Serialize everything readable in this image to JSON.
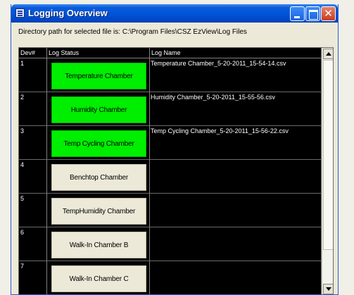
{
  "window": {
    "title": "Logging Overview"
  },
  "path_label": "Directory path for selected file is: C:\\Program Files\\CSZ EzView\\Log Files",
  "table": {
    "headers": {
      "dev": "Dev#",
      "status": "Log Status",
      "name": "Log Name"
    },
    "rows": [
      {
        "dev": "1",
        "status": "Temperature Chamber",
        "active": true,
        "log_name": "Temperature Chamber_5-20-2011_15-54-14.csv"
      },
      {
        "dev": "2",
        "status": "Humidity Chamber",
        "active": true,
        "log_name": "Humidity Chamber_5-20-2011_15-55-56.csv"
      },
      {
        "dev": "3",
        "status": "Temp Cycling Chamber",
        "active": true,
        "log_name": "Temp Cycling Chamber_5-20-2011_15-56-22.csv"
      },
      {
        "dev": "4",
        "status": "Benchtop Chamber",
        "active": false,
        "log_name": ""
      },
      {
        "dev": "5",
        "status": "TempHumidity Chamber",
        "active": false,
        "log_name": ""
      },
      {
        "dev": "6",
        "status": "Walk-In Chamber B",
        "active": false,
        "log_name": ""
      },
      {
        "dev": "7",
        "status": "Walk-In Chamber C",
        "active": false,
        "log_name": ""
      }
    ]
  },
  "colors": {
    "active_status": "#00ee00",
    "inactive_status": "#ece9d8",
    "grid_background": "#000000",
    "title_bar": "#0052d6"
  },
  "icons": {
    "window": "app-window-icon",
    "minimize": "minimize-icon",
    "maximize": "maximize-icon",
    "close": "close-icon",
    "scroll_up": "arrow-up-icon",
    "scroll_down": "arrow-down-icon"
  }
}
